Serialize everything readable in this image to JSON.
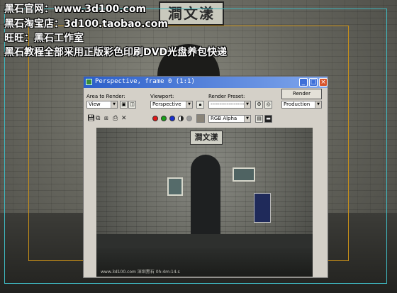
{
  "overlay": {
    "line1": "黑石官网：www.3d100.com",
    "line2": "黑石淘宝店：3d100.taobao.com",
    "line3": "旺旺：黑石工作室",
    "line4": "黑石教程全部采用正版彩色印刷DVD光盘养包快递"
  },
  "scene": {
    "sign_text": "澗文漾"
  },
  "window": {
    "title": "Perspective, frame 0 (1:1)",
    "controls": {
      "minimize": "_",
      "maximize": "□",
      "close": "×"
    },
    "area_label": "Area to Render:",
    "area_value": "View",
    "viewport_label": "Viewport:",
    "viewport_value": "Perspective",
    "preset_label": "Render Preset:",
    "preset_value": "--------------------",
    "render_button": "Render",
    "production_value": "Production",
    "channel_value": "RGB Alpha",
    "render_image": {
      "sign_text": "澗文漾",
      "stamp": "www.3d100.com    深圳黑石    0h:4m:14.s"
    }
  },
  "colors": {
    "titlebar": "#2c5fc9",
    "channel_red": "#e01818",
    "channel_green": "#18a018",
    "channel_blue": "#1830d0",
    "overlay_cyan_frame": "#3fb8c0",
    "overlay_orange_frame": "#c89018"
  },
  "icons": [
    "save-icon",
    "copy-icon",
    "clone-icon",
    "print-icon",
    "clear-icon",
    "lock-icon",
    "environment-icon",
    "render-setup-icon",
    "mono-icon",
    "display-icon"
  ]
}
